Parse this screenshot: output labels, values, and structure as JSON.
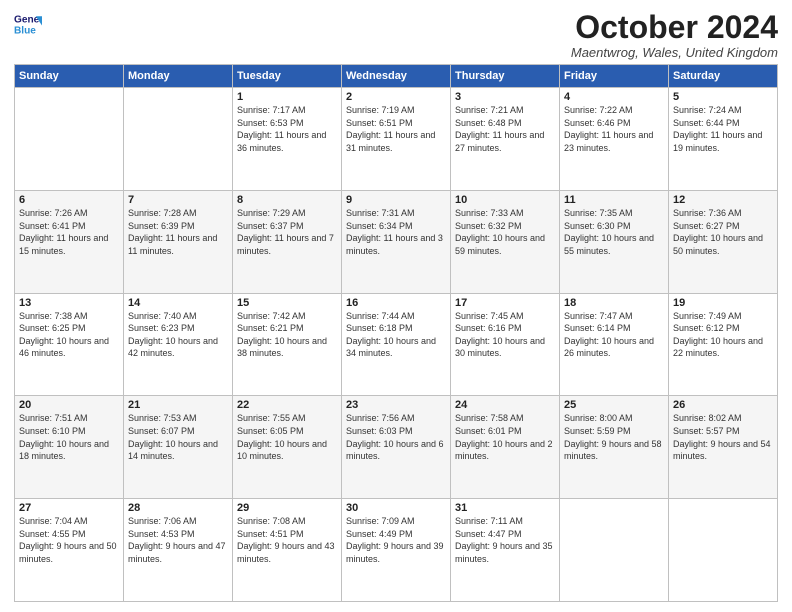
{
  "logo": {
    "line1": "General",
    "line2": "Blue"
  },
  "title": "October 2024",
  "subtitle": "Maentwrog, Wales, United Kingdom",
  "days_of_week": [
    "Sunday",
    "Monday",
    "Tuesday",
    "Wednesday",
    "Thursday",
    "Friday",
    "Saturday"
  ],
  "weeks": [
    [
      null,
      null,
      {
        "day": "1",
        "sunrise": "Sunrise: 7:17 AM",
        "sunset": "Sunset: 6:53 PM",
        "daylight": "Daylight: 11 hours and 36 minutes."
      },
      {
        "day": "2",
        "sunrise": "Sunrise: 7:19 AM",
        "sunset": "Sunset: 6:51 PM",
        "daylight": "Daylight: 11 hours and 31 minutes."
      },
      {
        "day": "3",
        "sunrise": "Sunrise: 7:21 AM",
        "sunset": "Sunset: 6:48 PM",
        "daylight": "Daylight: 11 hours and 27 minutes."
      },
      {
        "day": "4",
        "sunrise": "Sunrise: 7:22 AM",
        "sunset": "Sunset: 6:46 PM",
        "daylight": "Daylight: 11 hours and 23 minutes."
      },
      {
        "day": "5",
        "sunrise": "Sunrise: 7:24 AM",
        "sunset": "Sunset: 6:44 PM",
        "daylight": "Daylight: 11 hours and 19 minutes."
      }
    ],
    [
      {
        "day": "6",
        "sunrise": "Sunrise: 7:26 AM",
        "sunset": "Sunset: 6:41 PM",
        "daylight": "Daylight: 11 hours and 15 minutes."
      },
      {
        "day": "7",
        "sunrise": "Sunrise: 7:28 AM",
        "sunset": "Sunset: 6:39 PM",
        "daylight": "Daylight: 11 hours and 11 minutes."
      },
      {
        "day": "8",
        "sunrise": "Sunrise: 7:29 AM",
        "sunset": "Sunset: 6:37 PM",
        "daylight": "Daylight: 11 hours and 7 minutes."
      },
      {
        "day": "9",
        "sunrise": "Sunrise: 7:31 AM",
        "sunset": "Sunset: 6:34 PM",
        "daylight": "Daylight: 11 hours and 3 minutes."
      },
      {
        "day": "10",
        "sunrise": "Sunrise: 7:33 AM",
        "sunset": "Sunset: 6:32 PM",
        "daylight": "Daylight: 10 hours and 59 minutes."
      },
      {
        "day": "11",
        "sunrise": "Sunrise: 7:35 AM",
        "sunset": "Sunset: 6:30 PM",
        "daylight": "Daylight: 10 hours and 55 minutes."
      },
      {
        "day": "12",
        "sunrise": "Sunrise: 7:36 AM",
        "sunset": "Sunset: 6:27 PM",
        "daylight": "Daylight: 10 hours and 50 minutes."
      }
    ],
    [
      {
        "day": "13",
        "sunrise": "Sunrise: 7:38 AM",
        "sunset": "Sunset: 6:25 PM",
        "daylight": "Daylight: 10 hours and 46 minutes."
      },
      {
        "day": "14",
        "sunrise": "Sunrise: 7:40 AM",
        "sunset": "Sunset: 6:23 PM",
        "daylight": "Daylight: 10 hours and 42 minutes."
      },
      {
        "day": "15",
        "sunrise": "Sunrise: 7:42 AM",
        "sunset": "Sunset: 6:21 PM",
        "daylight": "Daylight: 10 hours and 38 minutes."
      },
      {
        "day": "16",
        "sunrise": "Sunrise: 7:44 AM",
        "sunset": "Sunset: 6:18 PM",
        "daylight": "Daylight: 10 hours and 34 minutes."
      },
      {
        "day": "17",
        "sunrise": "Sunrise: 7:45 AM",
        "sunset": "Sunset: 6:16 PM",
        "daylight": "Daylight: 10 hours and 30 minutes."
      },
      {
        "day": "18",
        "sunrise": "Sunrise: 7:47 AM",
        "sunset": "Sunset: 6:14 PM",
        "daylight": "Daylight: 10 hours and 26 minutes."
      },
      {
        "day": "19",
        "sunrise": "Sunrise: 7:49 AM",
        "sunset": "Sunset: 6:12 PM",
        "daylight": "Daylight: 10 hours and 22 minutes."
      }
    ],
    [
      {
        "day": "20",
        "sunrise": "Sunrise: 7:51 AM",
        "sunset": "Sunset: 6:10 PM",
        "daylight": "Daylight: 10 hours and 18 minutes."
      },
      {
        "day": "21",
        "sunrise": "Sunrise: 7:53 AM",
        "sunset": "Sunset: 6:07 PM",
        "daylight": "Daylight: 10 hours and 14 minutes."
      },
      {
        "day": "22",
        "sunrise": "Sunrise: 7:55 AM",
        "sunset": "Sunset: 6:05 PM",
        "daylight": "Daylight: 10 hours and 10 minutes."
      },
      {
        "day": "23",
        "sunrise": "Sunrise: 7:56 AM",
        "sunset": "Sunset: 6:03 PM",
        "daylight": "Daylight: 10 hours and 6 minutes."
      },
      {
        "day": "24",
        "sunrise": "Sunrise: 7:58 AM",
        "sunset": "Sunset: 6:01 PM",
        "daylight": "Daylight: 10 hours and 2 minutes."
      },
      {
        "day": "25",
        "sunrise": "Sunrise: 8:00 AM",
        "sunset": "Sunset: 5:59 PM",
        "daylight": "Daylight: 9 hours and 58 minutes."
      },
      {
        "day": "26",
        "sunrise": "Sunrise: 8:02 AM",
        "sunset": "Sunset: 5:57 PM",
        "daylight": "Daylight: 9 hours and 54 minutes."
      }
    ],
    [
      {
        "day": "27",
        "sunrise": "Sunrise: 7:04 AM",
        "sunset": "Sunset: 4:55 PM",
        "daylight": "Daylight: 9 hours and 50 minutes."
      },
      {
        "day": "28",
        "sunrise": "Sunrise: 7:06 AM",
        "sunset": "Sunset: 4:53 PM",
        "daylight": "Daylight: 9 hours and 47 minutes."
      },
      {
        "day": "29",
        "sunrise": "Sunrise: 7:08 AM",
        "sunset": "Sunset: 4:51 PM",
        "daylight": "Daylight: 9 hours and 43 minutes."
      },
      {
        "day": "30",
        "sunrise": "Sunrise: 7:09 AM",
        "sunset": "Sunset: 4:49 PM",
        "daylight": "Daylight: 9 hours and 39 minutes."
      },
      {
        "day": "31",
        "sunrise": "Sunrise: 7:11 AM",
        "sunset": "Sunset: 4:47 PM",
        "daylight": "Daylight: 9 hours and 35 minutes."
      },
      null,
      null
    ]
  ]
}
